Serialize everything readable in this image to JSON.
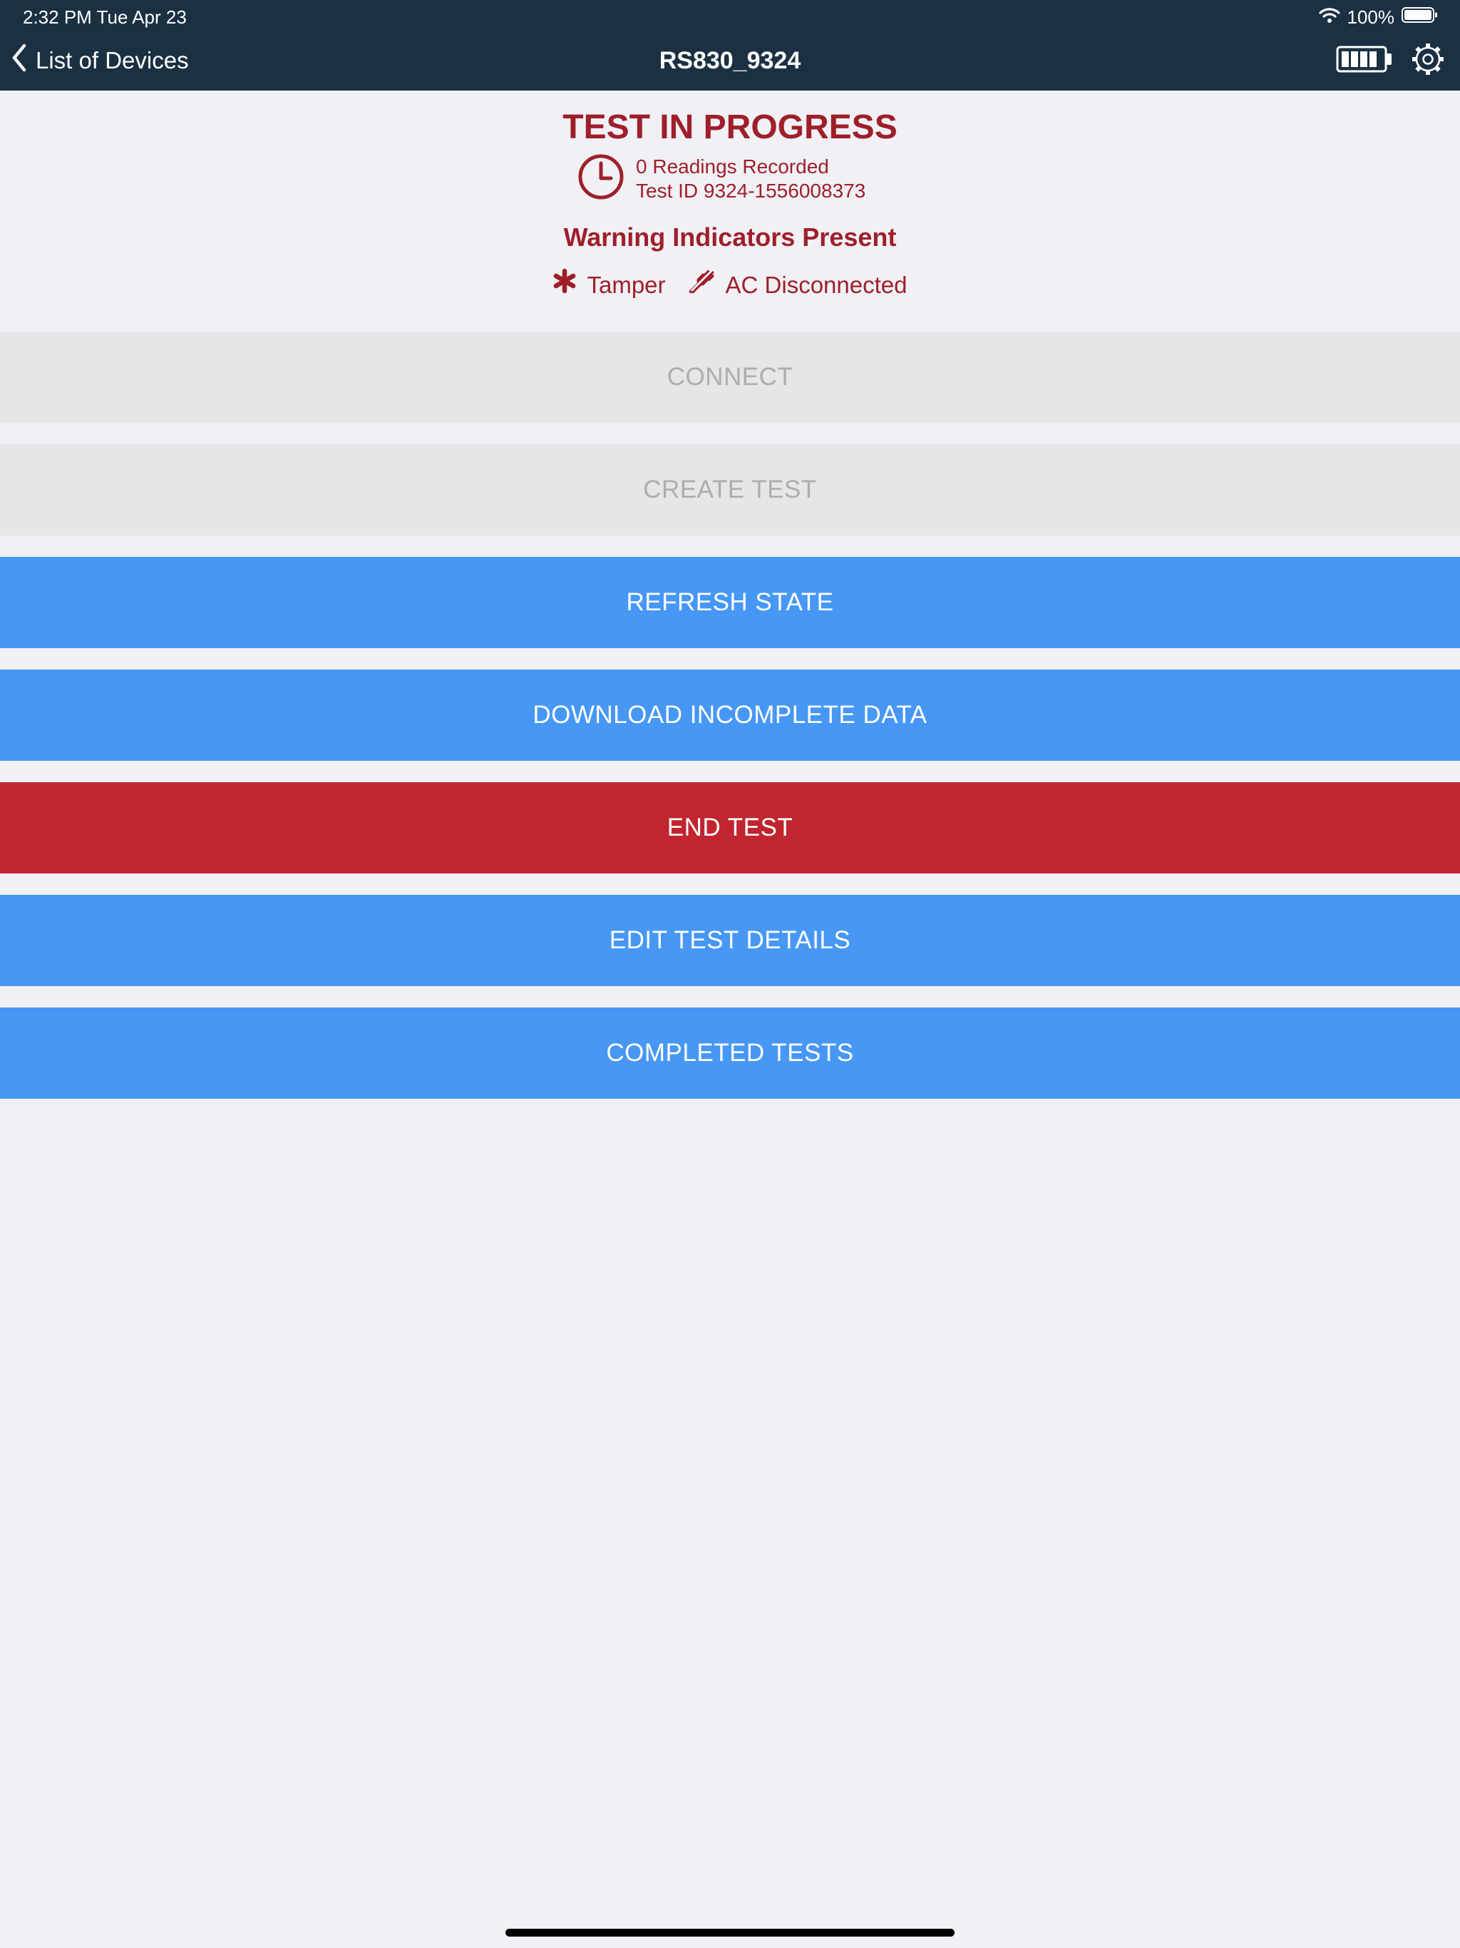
{
  "status_bar": {
    "time_date": "2:32 PM   Tue Apr 23",
    "battery_percent": "100%",
    "battery_level": 1.0
  },
  "nav": {
    "back_label": "List of Devices",
    "title": "RS830_9324",
    "device_battery_icon": "battery-full-icon",
    "settings_icon": "gear-icon"
  },
  "test_status": {
    "title": "TEST IN PROGRESS",
    "readings": "0 Readings Recorded",
    "test_id": "Test ID 9324-1556008373",
    "clock_icon": "clock-icon",
    "warning_heading": "Warning Indicators Present",
    "indicators": [
      {
        "icon": "asterisk-icon",
        "label": "Tamper"
      },
      {
        "icon": "unplugged-icon",
        "label": "AC Disconnected"
      }
    ]
  },
  "actions": {
    "connect": "CONNECT",
    "create_test": "CREATE TEST",
    "refresh_state": "REFRESH STATE",
    "download_incomplete": "DOWNLOAD INCOMPLETE DATA",
    "end_test": "END TEST",
    "edit_test_details": "EDIT TEST DETAILS",
    "completed_tests": "COMPLETED TESTS"
  },
  "colors": {
    "nav_background": "#1b3042",
    "warning_red": "#9e1f2a",
    "primary_blue": "#4797f5",
    "danger_red": "#c1252f",
    "disabled_gray": "#e6e6e8",
    "page_background": "#f0f0f5"
  }
}
